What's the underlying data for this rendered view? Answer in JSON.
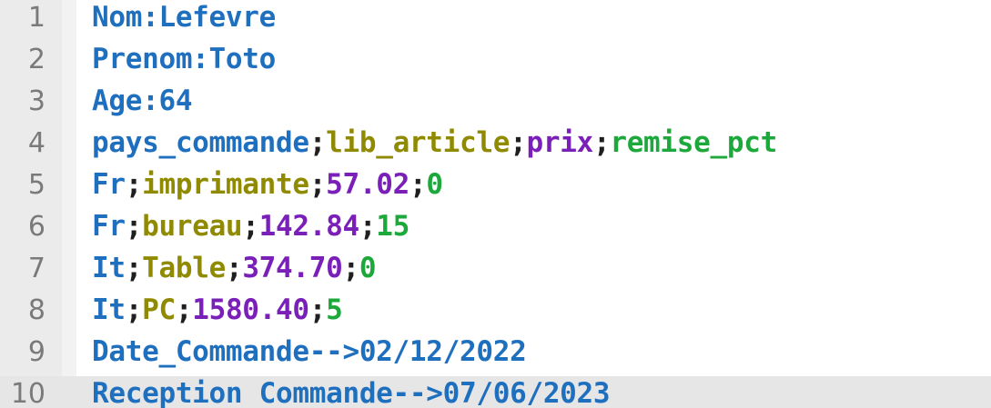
{
  "editor": {
    "lines": [
      {
        "number": "1",
        "segments": [
          {
            "text": "Nom:Lefevre",
            "color": "#1f6fbf"
          }
        ]
      },
      {
        "number": "2",
        "segments": [
          {
            "text": "Prenom:Toto",
            "color": "#1f6fbf"
          }
        ]
      },
      {
        "number": "3",
        "segments": [
          {
            "text": "Age:64",
            "color": "#1f6fbf"
          }
        ]
      },
      {
        "number": "4",
        "segments": [
          {
            "text": "pays_commande",
            "color": "#1f6fbf"
          },
          {
            "text": ";",
            "color": "#1f1f1f"
          },
          {
            "text": "lib_article",
            "color": "#8f8a00"
          },
          {
            "text": ";",
            "color": "#1f1f1f"
          },
          {
            "text": "prix",
            "color": "#7a1fb8"
          },
          {
            "text": ";",
            "color": "#1f1f1f"
          },
          {
            "text": "remise_pct",
            "color": "#1ca83a"
          }
        ]
      },
      {
        "number": "5",
        "segments": [
          {
            "text": "Fr",
            "color": "#1f6fbf"
          },
          {
            "text": ";",
            "color": "#1f1f1f"
          },
          {
            "text": "imprimante",
            "color": "#8f8a00"
          },
          {
            "text": ";",
            "color": "#1f1f1f"
          },
          {
            "text": "57.02",
            "color": "#7a1fb8"
          },
          {
            "text": ";",
            "color": "#1f1f1f"
          },
          {
            "text": "0",
            "color": "#1ca83a"
          }
        ]
      },
      {
        "number": "6",
        "segments": [
          {
            "text": "Fr",
            "color": "#1f6fbf"
          },
          {
            "text": ";",
            "color": "#1f1f1f"
          },
          {
            "text": "bureau",
            "color": "#8f8a00"
          },
          {
            "text": ";",
            "color": "#1f1f1f"
          },
          {
            "text": "142.84",
            "color": "#7a1fb8"
          },
          {
            "text": ";",
            "color": "#1f1f1f"
          },
          {
            "text": "15",
            "color": "#1ca83a"
          }
        ]
      },
      {
        "number": "7",
        "segments": [
          {
            "text": "It",
            "color": "#1f6fbf"
          },
          {
            "text": ";",
            "color": "#1f1f1f"
          },
          {
            "text": "Table",
            "color": "#8f8a00"
          },
          {
            "text": ";",
            "color": "#1f1f1f"
          },
          {
            "text": "374.70",
            "color": "#7a1fb8"
          },
          {
            "text": ";",
            "color": "#1f1f1f"
          },
          {
            "text": "0",
            "color": "#1ca83a"
          }
        ]
      },
      {
        "number": "8",
        "segments": [
          {
            "text": "It",
            "color": "#1f6fbf"
          },
          {
            "text": ";",
            "color": "#1f1f1f"
          },
          {
            "text": "PC",
            "color": "#8f8a00"
          },
          {
            "text": ";",
            "color": "#1f1f1f"
          },
          {
            "text": "1580.40",
            "color": "#7a1fb8"
          },
          {
            "text": ";",
            "color": "#1f1f1f"
          },
          {
            "text": "5",
            "color": "#1ca83a"
          }
        ]
      },
      {
        "number": "9",
        "segments": [
          {
            "text": "Date_Commande-->02/12/2022",
            "color": "#1f6fbf"
          }
        ]
      },
      {
        "number": "10",
        "segments": [
          {
            "text": "Reception Commande-->07/06/2023",
            "color": "#1f6fbf"
          }
        ],
        "current": true
      }
    ]
  }
}
